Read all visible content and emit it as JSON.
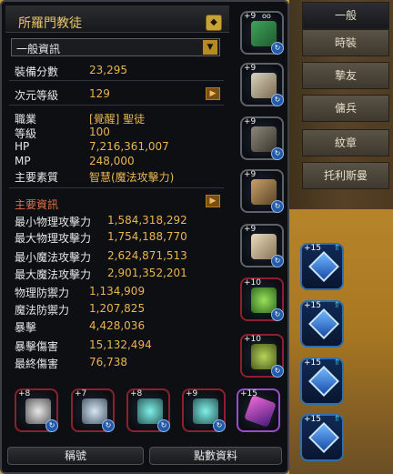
{
  "title": "所羅門教徒",
  "filter": "一般資訊",
  "tabs": [
    "一般",
    "時裝",
    "摯友",
    "傭兵",
    "紋章",
    "托利斯曼"
  ],
  "general": [
    {
      "label": "裝備分數",
      "value": "23,295"
    },
    {
      "label": "次元等級",
      "value": "129"
    }
  ],
  "info": [
    {
      "label": "職業",
      "value": "[覺醒] 聖徒"
    },
    {
      "label": "等級",
      "value": "100"
    },
    {
      "label": "HP",
      "value": "7,216,361,007"
    },
    {
      "label": "MP",
      "value": "248,000"
    },
    {
      "label": "主要素質",
      "value": "智慧(魔法攻擊力)"
    }
  ],
  "main_stats_title": "主要資訊",
  "stats": [
    {
      "label": "最小物理攻擊力",
      "value": "1,584,318,292"
    },
    {
      "label": "最大物理攻擊力",
      "value": "1,754,188,770"
    },
    {
      "label": "最小魔法攻擊力",
      "value": "2,624,871,513"
    },
    {
      "label": "最大魔法攻擊力",
      "value": "2,901,352,201"
    },
    {
      "label": "物理防禦力",
      "value": "1,134,909"
    },
    {
      "label": "魔法防禦力",
      "value": "1,207,825"
    },
    {
      "label": "暴擊",
      "value": "4,428,036"
    },
    {
      "label": "暴擊傷害",
      "value": "15,132,494"
    },
    {
      "label": "最終傷害",
      "value": "76,738"
    }
  ],
  "equip_right": [
    "+9",
    "+9",
    "+9",
    "+9",
    "+9",
    "+10",
    "+10"
  ],
  "equip_right_top_tag": "oo",
  "equip_bottom": [
    "+8",
    "+7",
    "+8",
    "+9",
    "+15"
  ],
  "gems": [
    "+15",
    "+15",
    "+15",
    "+15"
  ],
  "footer": {
    "title_btn": "稱號",
    "points_btn": "點數資料"
  }
}
